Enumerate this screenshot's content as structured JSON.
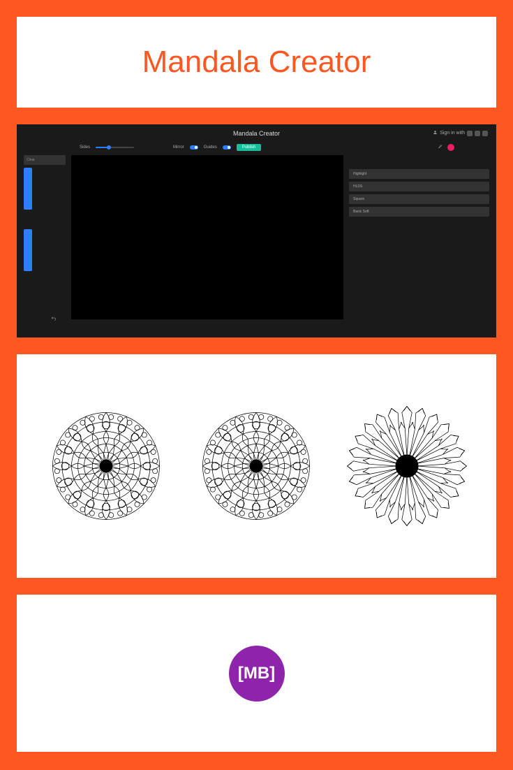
{
  "title": "Mandala Creator",
  "app": {
    "header": "Mandala Creator",
    "signin_label": "Sign in with",
    "toolbar": {
      "sides_label": "Sides",
      "mirror_label": "Mirror",
      "guides_label": "Guides",
      "publish_label": "Publish"
    },
    "left_tools": {
      "clear_label": "Clear"
    },
    "right_tools": {
      "highlight_label": "Highlight",
      "hlds_label": "HLDS",
      "square_label": "Square",
      "basic_soft_label": "Basic Soft"
    },
    "colors": {
      "primary_blue": "#2d7ff9",
      "accent_pink": "#e91e63",
      "publish_green": "#1abc9c"
    }
  },
  "logo": {
    "text": "[MB]",
    "bg_color": "#8e24aa"
  }
}
